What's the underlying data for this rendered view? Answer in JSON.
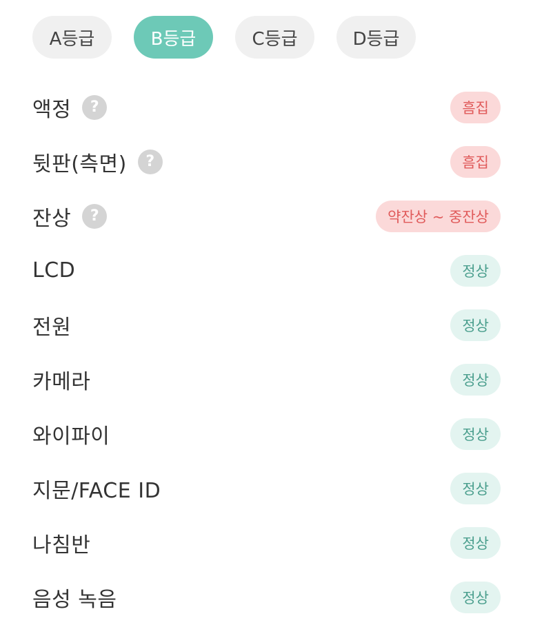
{
  "grade_tabs": [
    {
      "label": "A등급",
      "active": false
    },
    {
      "label": "B등급",
      "active": true
    },
    {
      "label": "C등급",
      "active": false
    },
    {
      "label": "D등급",
      "active": false
    }
  ],
  "help_glyph": "?",
  "items": [
    {
      "label": "액정",
      "has_help": true,
      "status": "흠집",
      "status_type": "bad"
    },
    {
      "label": "뒷판(측면)",
      "has_help": true,
      "status": "흠집",
      "status_type": "bad"
    },
    {
      "label": "잔상",
      "has_help": true,
      "status": "약잔상 ~ 중잔상",
      "status_type": "bad"
    },
    {
      "label": "LCD",
      "has_help": false,
      "status": "정상",
      "status_type": "good"
    },
    {
      "label": "전원",
      "has_help": false,
      "status": "정상",
      "status_type": "good"
    },
    {
      "label": "카메라",
      "has_help": false,
      "status": "정상",
      "status_type": "good"
    },
    {
      "label": "와이파이",
      "has_help": false,
      "status": "정상",
      "status_type": "good"
    },
    {
      "label": "지문/FACE ID",
      "has_help": false,
      "status": "정상",
      "status_type": "good"
    },
    {
      "label": "나침반",
      "has_help": false,
      "status": "정상",
      "status_type": "good"
    },
    {
      "label": "음성 녹음",
      "has_help": false,
      "status": "정상",
      "status_type": "good"
    }
  ],
  "colors": {
    "active_tab": "#6dc9b7",
    "inactive_tab": "#f0f0f0",
    "bad_badge_bg": "#fbd9d9",
    "bad_badge_text": "#e05a5a",
    "good_badge_bg": "#e3f4f0",
    "good_badge_text": "#4a9e8d"
  }
}
